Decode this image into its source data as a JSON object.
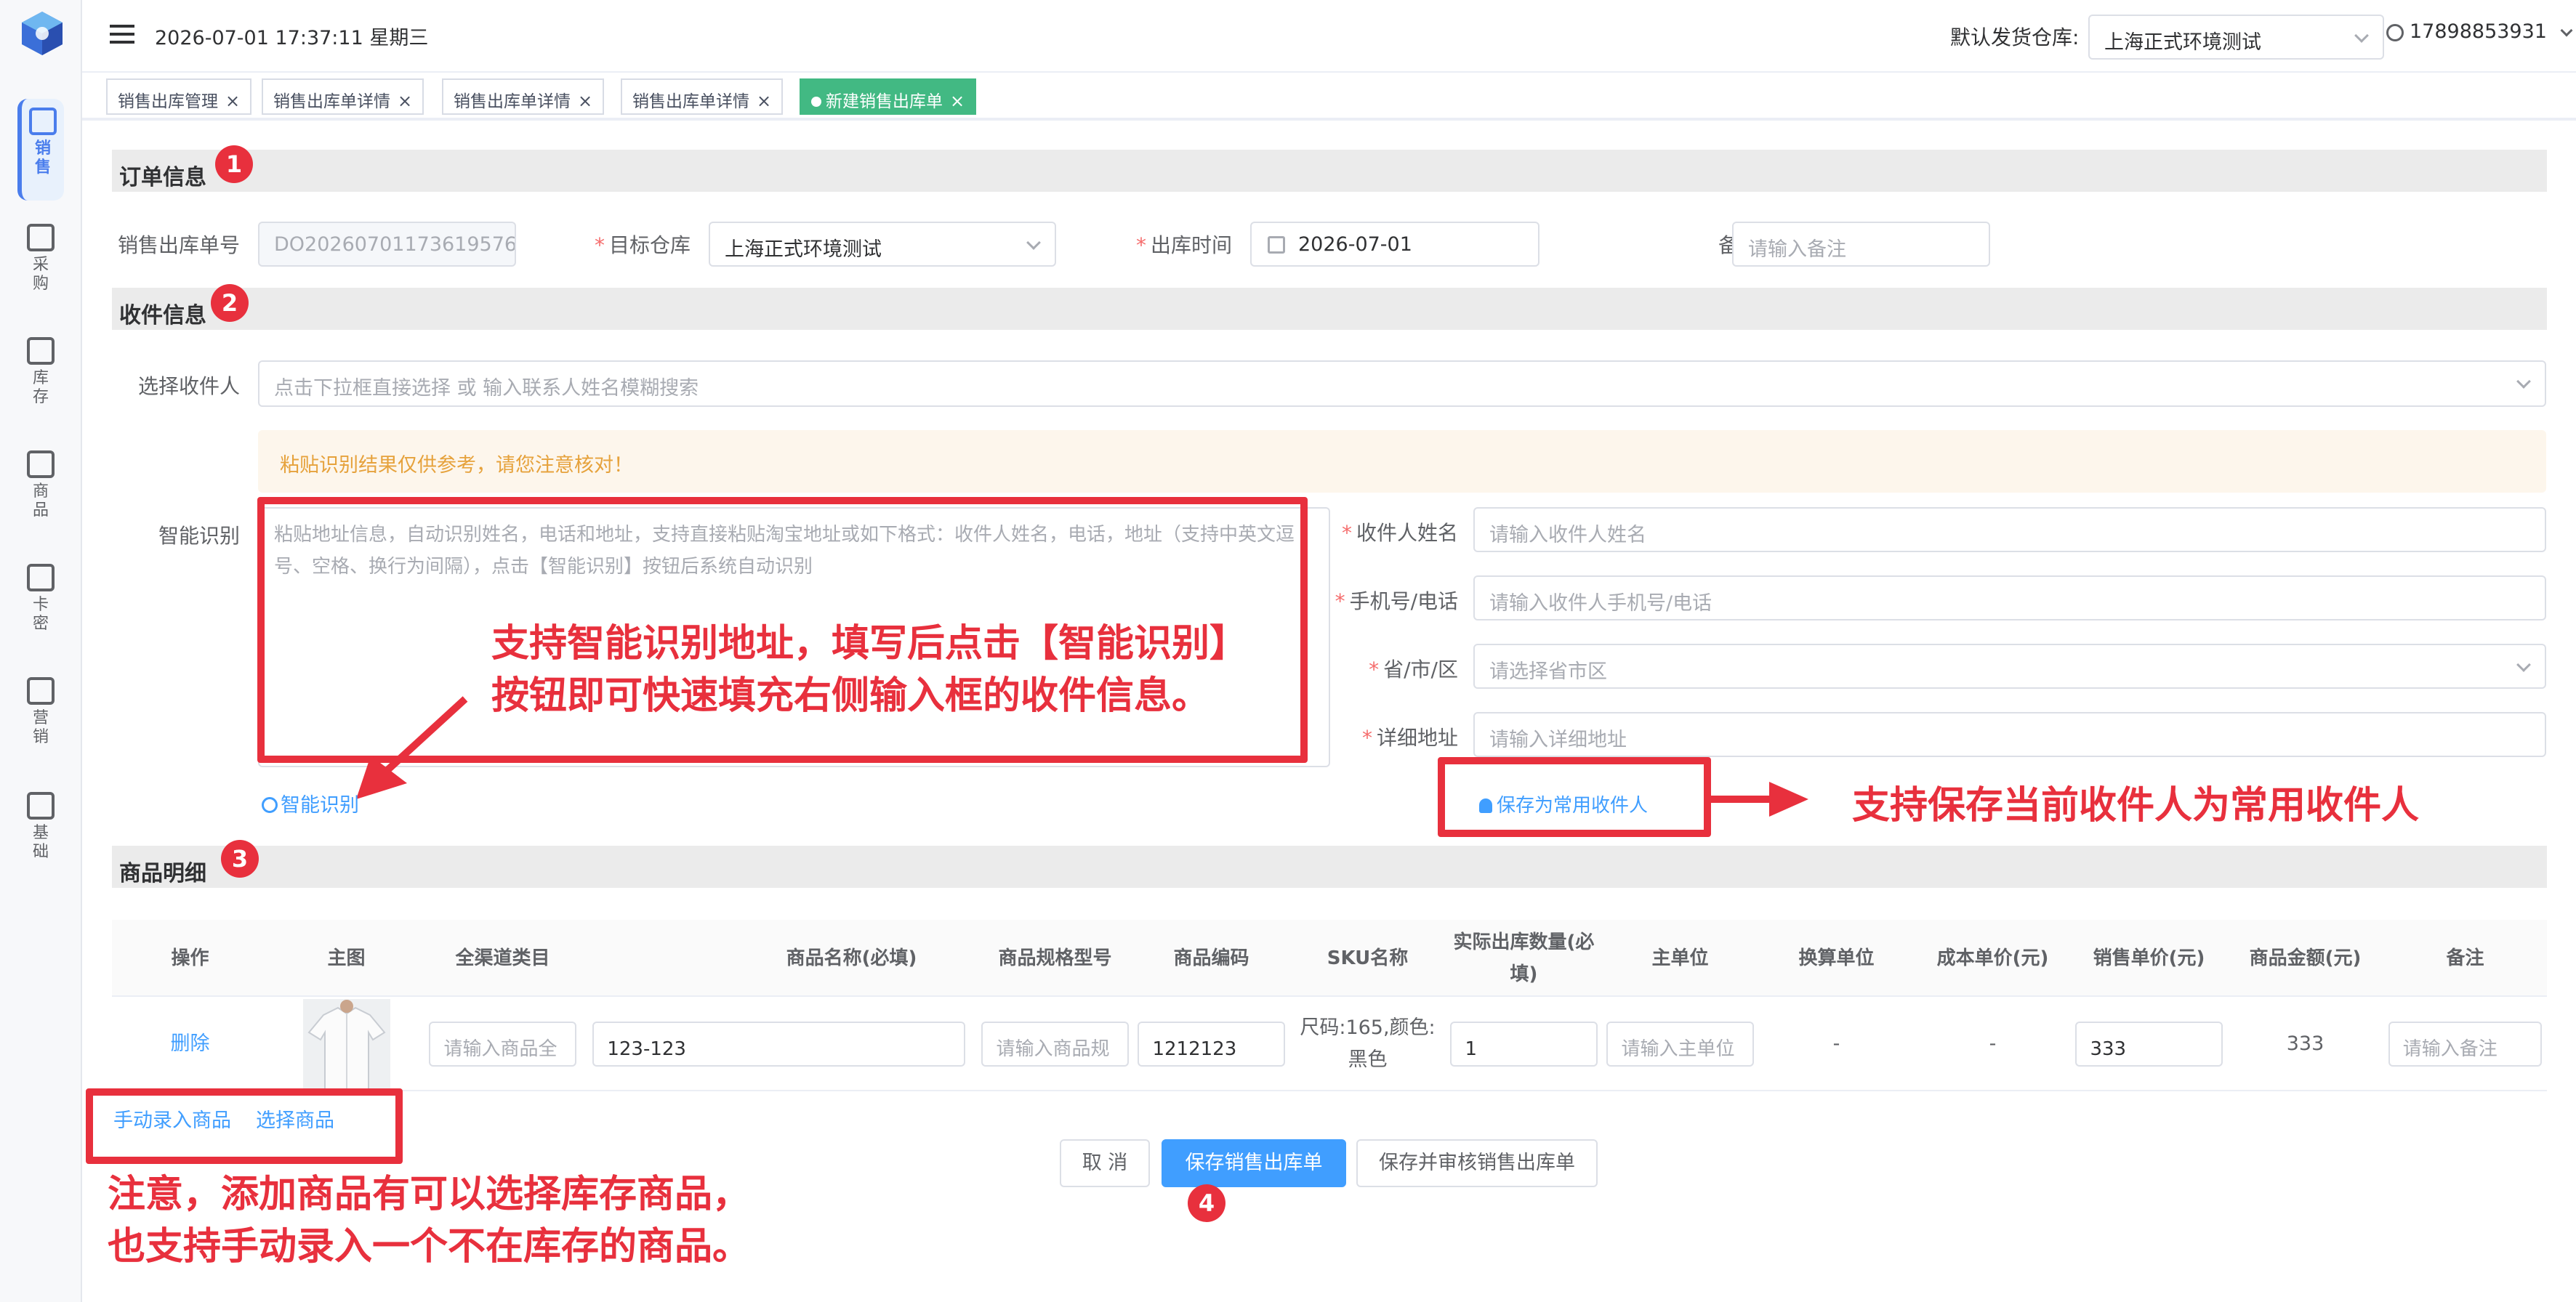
{
  "colors": {
    "accent": "#409eff",
    "annotation_red": "#e8303d",
    "tab_active": "#42b983",
    "warning": "#e6a23c"
  },
  "sidebar": {
    "items": [
      {
        "label": "销售",
        "icon": "bag-icon",
        "active": true
      },
      {
        "label": "采购",
        "icon": "cart-icon"
      },
      {
        "label": "库存",
        "icon": "box-icon"
      },
      {
        "label": "商品",
        "icon": "bag-icon"
      },
      {
        "label": "卡密",
        "icon": "bag-icon"
      },
      {
        "label": "营销",
        "icon": "bag-icon"
      },
      {
        "label": "基础",
        "icon": "book-icon"
      }
    ]
  },
  "header": {
    "datetime": "2026-07-01 17:37:11 星期三",
    "warehouse_label": "默认发货仓库:",
    "warehouse_value": "上海正式环境测试",
    "user": "17898853931"
  },
  "tabs": [
    {
      "label": "销售出库管理"
    },
    {
      "label": "销售出库单详情"
    },
    {
      "label": "销售出库单详情"
    },
    {
      "label": "销售出库单详情"
    },
    {
      "label": "新建销售出库单",
      "active": true
    }
  ],
  "sections": {
    "order": {
      "title": "订单信息",
      "badge": "1"
    },
    "receiver": {
      "title": "收件信息",
      "badge": "2"
    },
    "goods": {
      "title": "商品明细",
      "badge": "3"
    }
  },
  "order_form": {
    "order_no_label": "销售出库单号",
    "order_no_value": "DO20260701173619576",
    "warehouse_label": "目标仓库",
    "warehouse_value": "上海正式环境测试",
    "time_label": "出库时间",
    "time_value": "2026-07-01",
    "remark_label": "备注",
    "remark_placeholder": "请输入备注"
  },
  "receiver_form": {
    "select_label": "选择收件人",
    "select_placeholder": "点击下拉框直接选择 或 输入联系人姓名模糊搜索",
    "warning": "粘贴识别结果仅供参考，请您注意核对！",
    "smart_label": "智能识别",
    "smart_placeholder": "粘贴地址信息，自动识别姓名，电话和地址，支持直接粘贴淘宝地址或如下格式：收件人姓名，电话，地址（支持中英文逗号、空格、换行为间隔），点击【智能识别】按钮后系统自动识别",
    "smart_button": "智能识别",
    "name_label": "收件人姓名",
    "name_placeholder": "请输入收件人姓名",
    "phone_label": "手机号/电话",
    "phone_placeholder": "请输入收件人手机号/电话",
    "region_label": "省/市/区",
    "region_placeholder": "请选择省市区",
    "address_label": "详细地址",
    "address_placeholder": "请输入详细地址",
    "save_contact": "保存为常用收件人"
  },
  "annotations": {
    "smart_line1": "支持智能识别地址，填写后点击【智能识别】",
    "smart_line2": "按钮即可快速填充右侧输入框的收件信息。",
    "save_contact": "支持保存当前收件人为常用收件人",
    "goods_line1": "注意，添加商品有可以选择库存商品，",
    "goods_line2": "也支持手动录入一个不在库存的商品。",
    "submit_badge": "4"
  },
  "table": {
    "headers": [
      "操作",
      "主图",
      "全渠道类目",
      "商品名称(必填)",
      "商品规格型号",
      "商品编码",
      "SKU名称",
      "实际出库数量(必填)",
      "主单位",
      "换算单位",
      "成本单价(元)",
      "销售单价(元)",
      "商品金额(元)",
      "备注"
    ],
    "row": {
      "action": "删除",
      "category_placeholder": "请输入商品全",
      "name": "123-123",
      "spec_placeholder": "请输入商品规",
      "code": "1212123",
      "sku": "尺码:165,颜色:黑色",
      "qty": "1",
      "unit_placeholder": "请输入主单位",
      "conv_unit": "-",
      "cost": "-",
      "price": "333",
      "amount": "333",
      "remark_placeholder": "请输入备注"
    }
  },
  "goods_links": {
    "manual": "手动录入商品",
    "select": "选择商品"
  },
  "buttons": {
    "cancel": "取 消",
    "save": "保存销售出库单",
    "save_audit": "保存并审核销售出库单"
  }
}
